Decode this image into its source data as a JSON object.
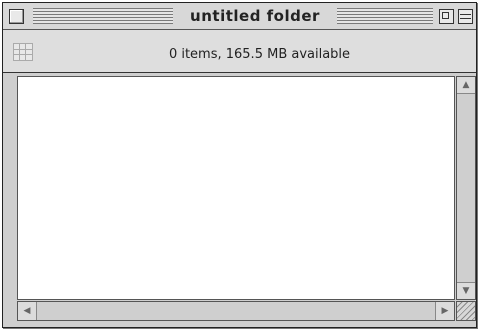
{
  "window": {
    "title": "untitled folder"
  },
  "infobar": {
    "status": "0 items, 165.5 MB available"
  },
  "scrollbar": {
    "up_glyph": "▲",
    "down_glyph": "▼",
    "left_glyph": "◀",
    "right_glyph": "▶"
  },
  "icons": {
    "close": "close-box-icon",
    "zoom": "zoom-box-icon",
    "collapse": "collapse-box-icon",
    "view": "icon-view-grid-icon",
    "grow": "resize-grow-icon"
  }
}
